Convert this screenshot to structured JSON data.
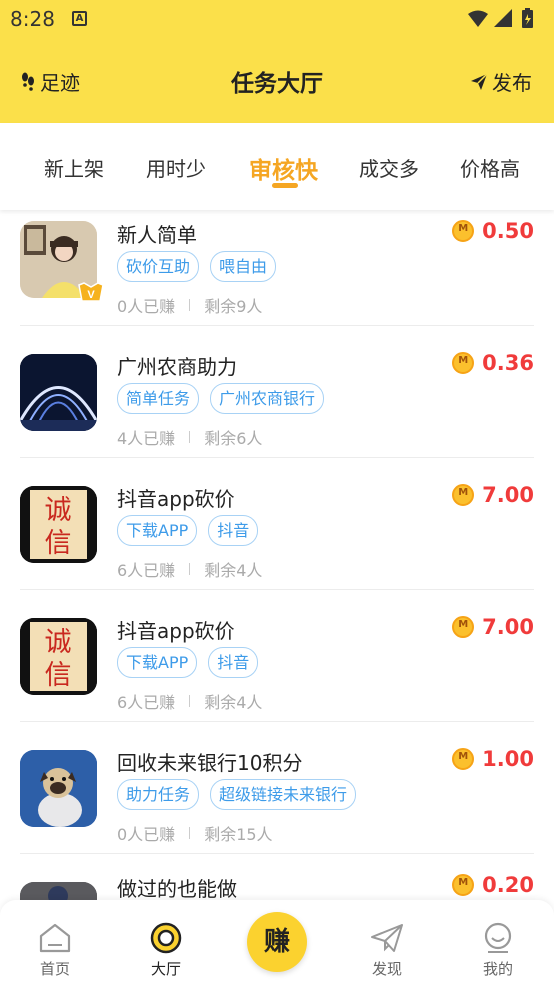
{
  "status_bar": {
    "time": "8:28",
    "notification_icon": "A"
  },
  "header": {
    "left_label": "足迹",
    "title": "任务大厅",
    "right_label": "发布"
  },
  "tabs": [
    {
      "label": "新上架",
      "active": false
    },
    {
      "label": "用时少",
      "active": false
    },
    {
      "label": "审核快",
      "active": true
    },
    {
      "label": "成交多",
      "active": false
    },
    {
      "label": "价格高",
      "active": false
    }
  ],
  "tasks": [
    {
      "title": "新人简单",
      "price": "0.50",
      "tags": [
        "砍价互助",
        "喂自由"
      ],
      "earned": "0人已赚",
      "remaining": "剩余9人",
      "thumb": "avatar-photo"
    },
    {
      "title": "广州农商助力",
      "price": "0.36",
      "tags": [
        "简单任务",
        "广州农商银行"
      ],
      "earned": "4人已赚",
      "remaining": "剩余6人",
      "thumb": "bridge-night"
    },
    {
      "title": "抖音app砍价",
      "price": "7.00",
      "tags": [
        "下载APP",
        "抖音"
      ],
      "earned": "6人已赚",
      "remaining": "剩余4人",
      "thumb": "chengxin"
    },
    {
      "title": "抖音app砍价",
      "price": "7.00",
      "tags": [
        "下载APP",
        "抖音"
      ],
      "earned": "6人已赚",
      "remaining": "剩余4人",
      "thumb": "chengxin"
    },
    {
      "title": "回收未来银行10积分",
      "price": "1.00",
      "tags": [
        "助力任务",
        "超级链接未来银行"
      ],
      "earned": "0人已赚",
      "remaining": "剩余15人",
      "thumb": "dog"
    },
    {
      "title": "做过的也能做",
      "price": "0.20",
      "tags": [],
      "earned": "",
      "remaining": "",
      "thumb": "dark"
    }
  ],
  "thumb_text": {
    "chengxin_top": "诚",
    "chengxin_bottom": "信",
    "vip_badge": "V"
  },
  "coin_letter": "M",
  "bottom_nav": {
    "home": "首页",
    "hall": "大厅",
    "earn": "赚",
    "discover": "发现",
    "mine": "我的"
  },
  "colors": {
    "brand_yellow": "#fbe04a",
    "accent_orange": "#f5a623",
    "price_red": "#f03b3b",
    "tag_blue": "#3d9be9"
  }
}
